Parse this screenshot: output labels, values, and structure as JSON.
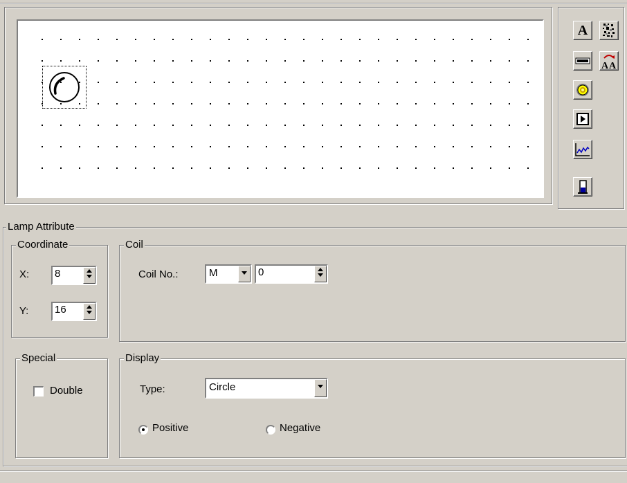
{
  "toolbox": {
    "items": [
      {
        "name": "text-tool",
        "glyph": "A"
      },
      {
        "name": "lamp-tool"
      },
      {
        "name": "button-tool"
      },
      {
        "name": "trend-tool"
      },
      {
        "name": "bar-tool"
      },
      {
        "name": "bitmap-tool"
      },
      {
        "name": "font-tool",
        "glyph": "AA"
      }
    ]
  },
  "lamp_attribute": {
    "title": "Lamp Attribute",
    "coordinate": {
      "title": "Coordinate",
      "x_label": "X:",
      "x_value": "8",
      "y_label": "Y:",
      "y_value": "16"
    },
    "coil": {
      "title": "Coil",
      "coil_no_label": "Coil No.:",
      "device": "M",
      "address": "0"
    },
    "special": {
      "title": "Special",
      "double_label": "Double",
      "double_checked": false
    },
    "display": {
      "title": "Display",
      "type_label": "Type:",
      "type_value": "Circle",
      "positive_label": "Positive",
      "negative_label": "Negative",
      "selected": "Positive"
    }
  }
}
